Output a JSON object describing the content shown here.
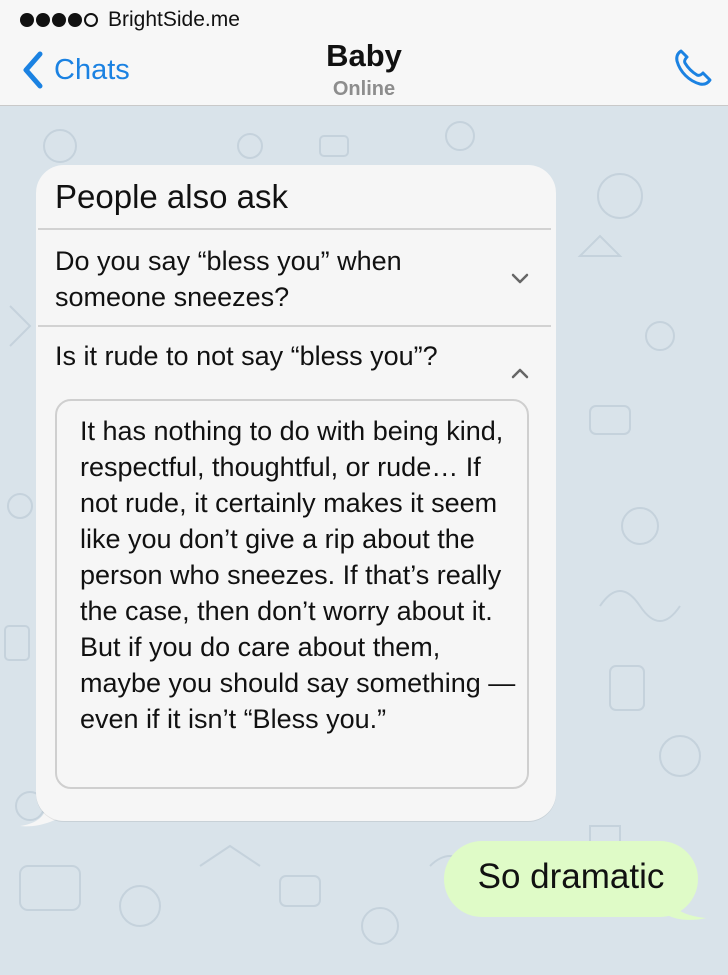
{
  "status_bar": {
    "carrier": "BrightSide.me",
    "signal_bars_filled": 4,
    "signal_bars_total": 5
  },
  "header": {
    "back_label": "Chats",
    "contact_name": "Baby",
    "contact_status": "Online",
    "accent_color": "#1b82e2"
  },
  "messages": {
    "incoming": {
      "card_title": "People also ask",
      "question_1": "Do you say “bless you” when someone sneezes?",
      "question_2": "Is it rude to not say “bless you”?",
      "answer": "It has nothing to do with being kind, respectful, thoughtful, or rude… If not rude, it certainly makes it seem like you don’t give a rip about the person who sneezes. If that’s really the case, then don’t worry about it. But if you do care about them, maybe you should say something — even if it isn’t “Bless you.”",
      "bubble_color": "#f6f6f6"
    },
    "outgoing": {
      "text": "So dramatic",
      "bubble_color": "#dffbc7"
    }
  },
  "icons": {
    "back": "chevron-left-icon",
    "call": "phone-icon",
    "collapsed": "chevron-down-icon",
    "expanded": "chevron-up-icon"
  }
}
